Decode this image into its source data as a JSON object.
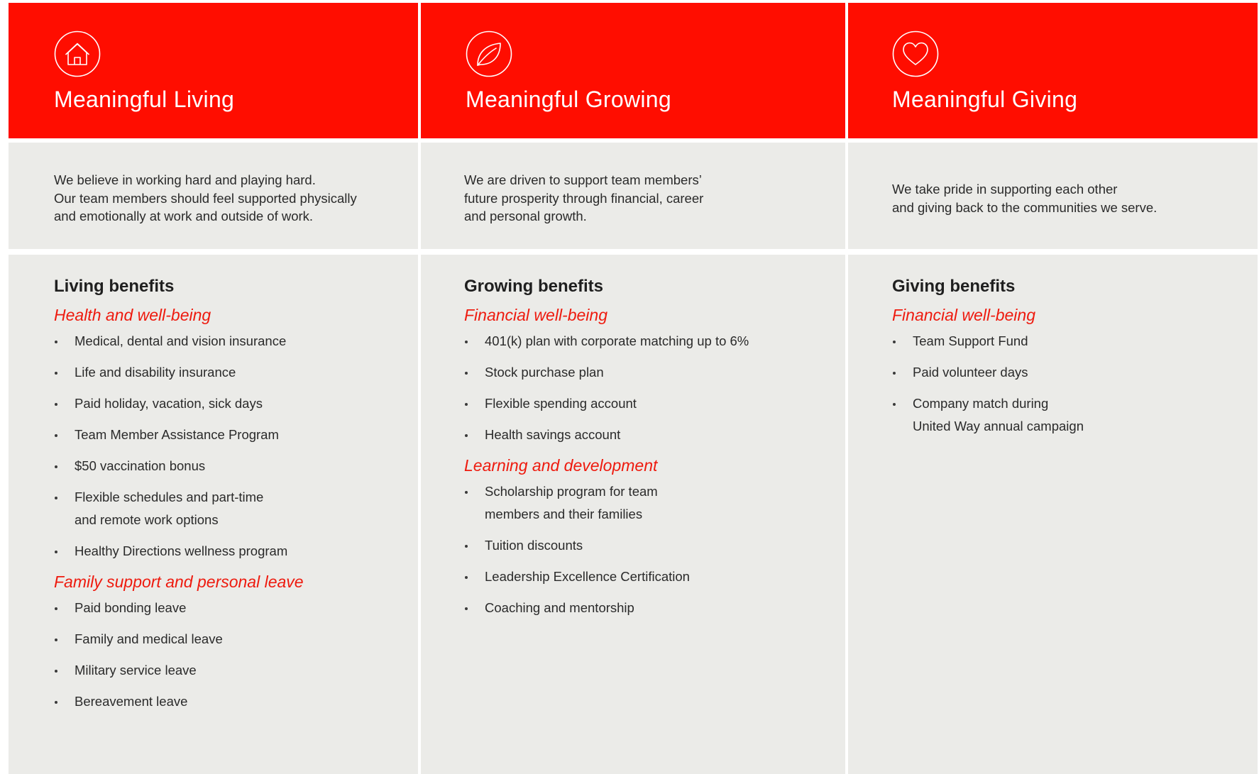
{
  "columns": [
    {
      "icon": "house-icon",
      "title": "Meaningful Living",
      "intro": "We believe in working hard and playing hard.\nOur team members should feel supported physically\nand emotionally at work and outside of work.",
      "benefits_title": "Living benefits",
      "sections": [
        {
          "heading": "Health and well-being",
          "items": [
            "Medical, dental and vision insurance",
            "Life and disability insurance",
            "Paid holiday, vacation, sick days",
            "Team Member Assistance Program",
            "$50 vaccination bonus",
            "Flexible schedules and part-time\nand remote work options",
            "Healthy Directions wellness program"
          ]
        },
        {
          "heading": "Family support and personal leave",
          "items": [
            "Paid bonding leave",
            "Family and medical leave",
            "Military service leave",
            "Bereavement leave"
          ]
        }
      ]
    },
    {
      "icon": "leaf-icon",
      "title": "Meaningful Growing",
      "intro": "We are driven to support team members’\nfuture prosperity through financial, career\nand personal growth.",
      "benefits_title": "Growing benefits",
      "sections": [
        {
          "heading": "Financial well-being",
          "items": [
            "401(k) plan with corporate matching up to 6%",
            "Stock purchase plan",
            "Flexible spending account",
            "Health savings account"
          ]
        },
        {
          "heading": "Learning and development",
          "items": [
            "Scholarship program for team\nmembers and their families",
            "Tuition discounts",
            "Leadership Excellence Certification",
            "Coaching and mentorship"
          ]
        }
      ]
    },
    {
      "icon": "heart-icon",
      "title": "Meaningful Giving",
      "intro": "We take pride in supporting each other\nand giving back to the communities we serve.",
      "benefits_title": "Giving benefits",
      "sections": [
        {
          "heading": "Financial well-being",
          "items": [
            "Team Support Fund",
            "Paid volunteer days",
            "Company match during\nUnited Way annual campaign"
          ]
        }
      ]
    }
  ]
}
